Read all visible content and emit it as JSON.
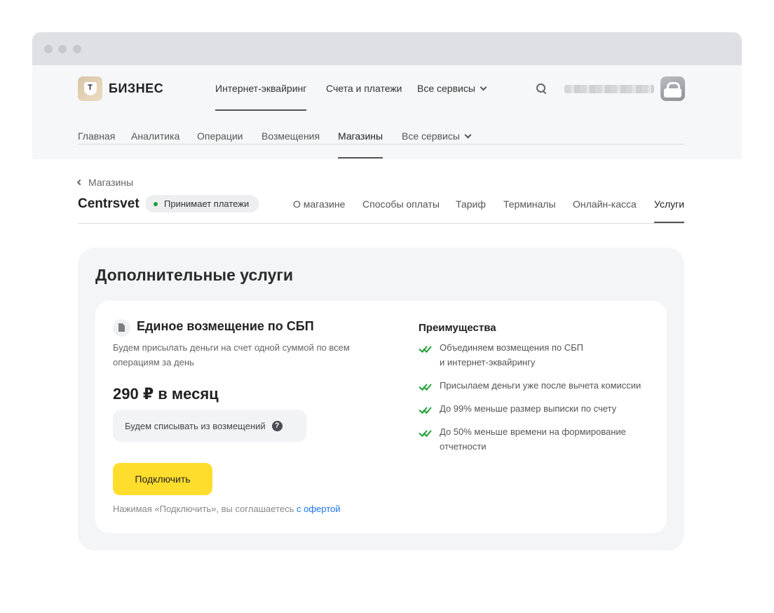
{
  "brand": {
    "logo_letter": "Т",
    "name": "БИЗНЕС"
  },
  "topnav": {
    "items": [
      {
        "label": "Интернет-эквайринг",
        "active": true
      },
      {
        "label": "Счета и платежи",
        "active": false
      },
      {
        "label": "Все сервисы",
        "active": false,
        "dropdown": true
      }
    ],
    "search_icon": "search-icon",
    "avatar_icon": "lock-avatar"
  },
  "subnav": {
    "items": [
      {
        "label": "Главная",
        "active": false
      },
      {
        "label": "Аналитика",
        "active": false
      },
      {
        "label": "Операции",
        "active": false
      },
      {
        "label": "Возмещения",
        "active": false
      },
      {
        "label": "Магазины",
        "active": true
      },
      {
        "label": "Все сервисы",
        "active": false,
        "dropdown": true
      }
    ]
  },
  "back_link": "Магазины",
  "shop": {
    "name": "Centrsvet",
    "status": "Принимает платежи",
    "status_color": "#21a038"
  },
  "shop_tabs": [
    {
      "label": "О магазине",
      "active": false
    },
    {
      "label": "Способы оплаты",
      "active": false
    },
    {
      "label": "Тариф",
      "active": false
    },
    {
      "label": "Терминалы",
      "active": false
    },
    {
      "label": "Онлайн-касса",
      "active": false
    },
    {
      "label": "Услуги",
      "active": true
    }
  ],
  "panel": {
    "title": "Дополнительные услуги",
    "service": {
      "icon": "document-icon",
      "title": "Единое возмещение по СБП",
      "description": "Будем присылать деньги на счет одной суммой по всем операциям за день",
      "price": "290 ₽ в месяц",
      "deduct_note": "Будем списывать из возмещений",
      "help_icon": "?",
      "connect_label": "Подключить",
      "connect_color": "#ffdd2d",
      "agree_text": "Нажимая «Подключить», вы соглашаетесь",
      "offer_link": "с офертой"
    },
    "advantages": {
      "title": "Преимущества",
      "items": [
        "Объединяем возмещения по СБП\nи интернет-эквайрингу",
        "Присылаем деньги уже после вычета комиссии",
        "До 99% меньше размер выписки по счету",
        "До 50% меньше времени на формирование отчетности"
      ]
    }
  }
}
